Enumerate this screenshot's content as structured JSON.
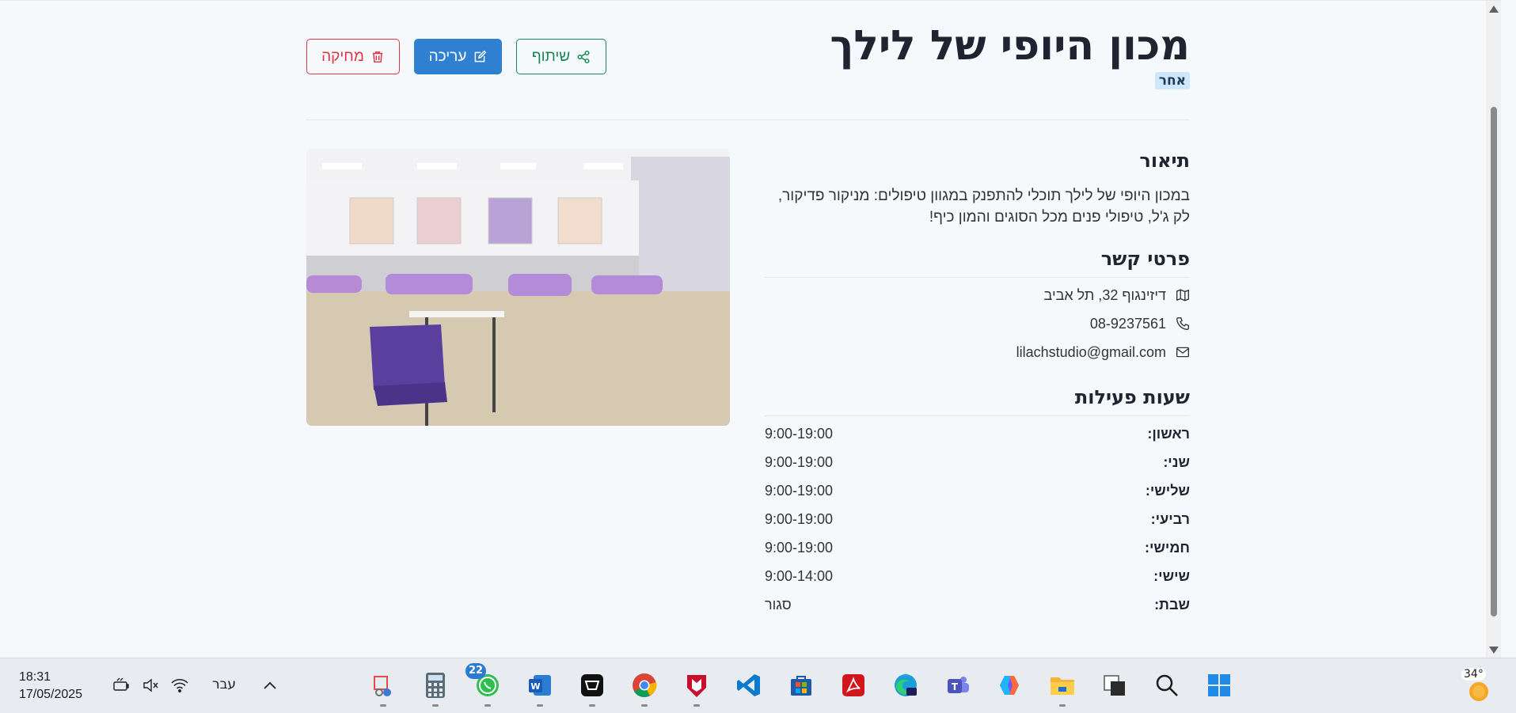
{
  "business": {
    "name": "מכון היופי של לילך",
    "category": "אחר"
  },
  "actions": {
    "delete_label": "מחיקה",
    "edit_label": "עריכה",
    "share_label": "שיתוף"
  },
  "description": {
    "heading": "תיאור",
    "text": "במכון היופי של לילך תוכלי להתפנק במגוון טיפולים: מניקור פדיקור, לק ג'ל, טיפולי פנים מכל הסוגים והמון כיף!"
  },
  "contact": {
    "heading": "פרטי קשר",
    "address": "דיזינגוף 32, תל אביב",
    "phone": "08-9237561",
    "email": "lilachstudio@gmail.com"
  },
  "hours": {
    "heading": "שעות פעילות",
    "rows": [
      {
        "day": "ראשון:",
        "time": "9:00-19:00"
      },
      {
        "day": "שני:",
        "time": "9:00-19:00"
      },
      {
        "day": "שלישי:",
        "time": "9:00-19:00"
      },
      {
        "day": "רביעי:",
        "time": "9:00-19:00"
      },
      {
        "day": "חמישי:",
        "time": "9:00-19:00"
      },
      {
        "day": "שישי:",
        "time": "9:00-14:00"
      },
      {
        "day": "שבת:",
        "time": "סגור"
      }
    ]
  },
  "taskbar": {
    "time": "18:31",
    "date": "17/05/2025",
    "language": "עבר",
    "whatsapp_badge": "22",
    "weather_temp": "34°",
    "apps": [
      "snipping-tool-icon",
      "calculator-icon",
      "whatsapp-icon",
      "word-icon",
      "capcut-icon",
      "chrome-icon",
      "mcafee-icon",
      "vscode-icon",
      "microsoft-store-icon",
      "acrobat-icon",
      "edge-icon",
      "teams-icon",
      "copilot-icon",
      "file-explorer-icon",
      "task-view-icon",
      "search-icon",
      "start-icon"
    ]
  },
  "colors": {
    "danger": "#dc3545",
    "primary": "#2f80d0",
    "success": "#198754",
    "badge_bg": "#cfe6fb"
  }
}
